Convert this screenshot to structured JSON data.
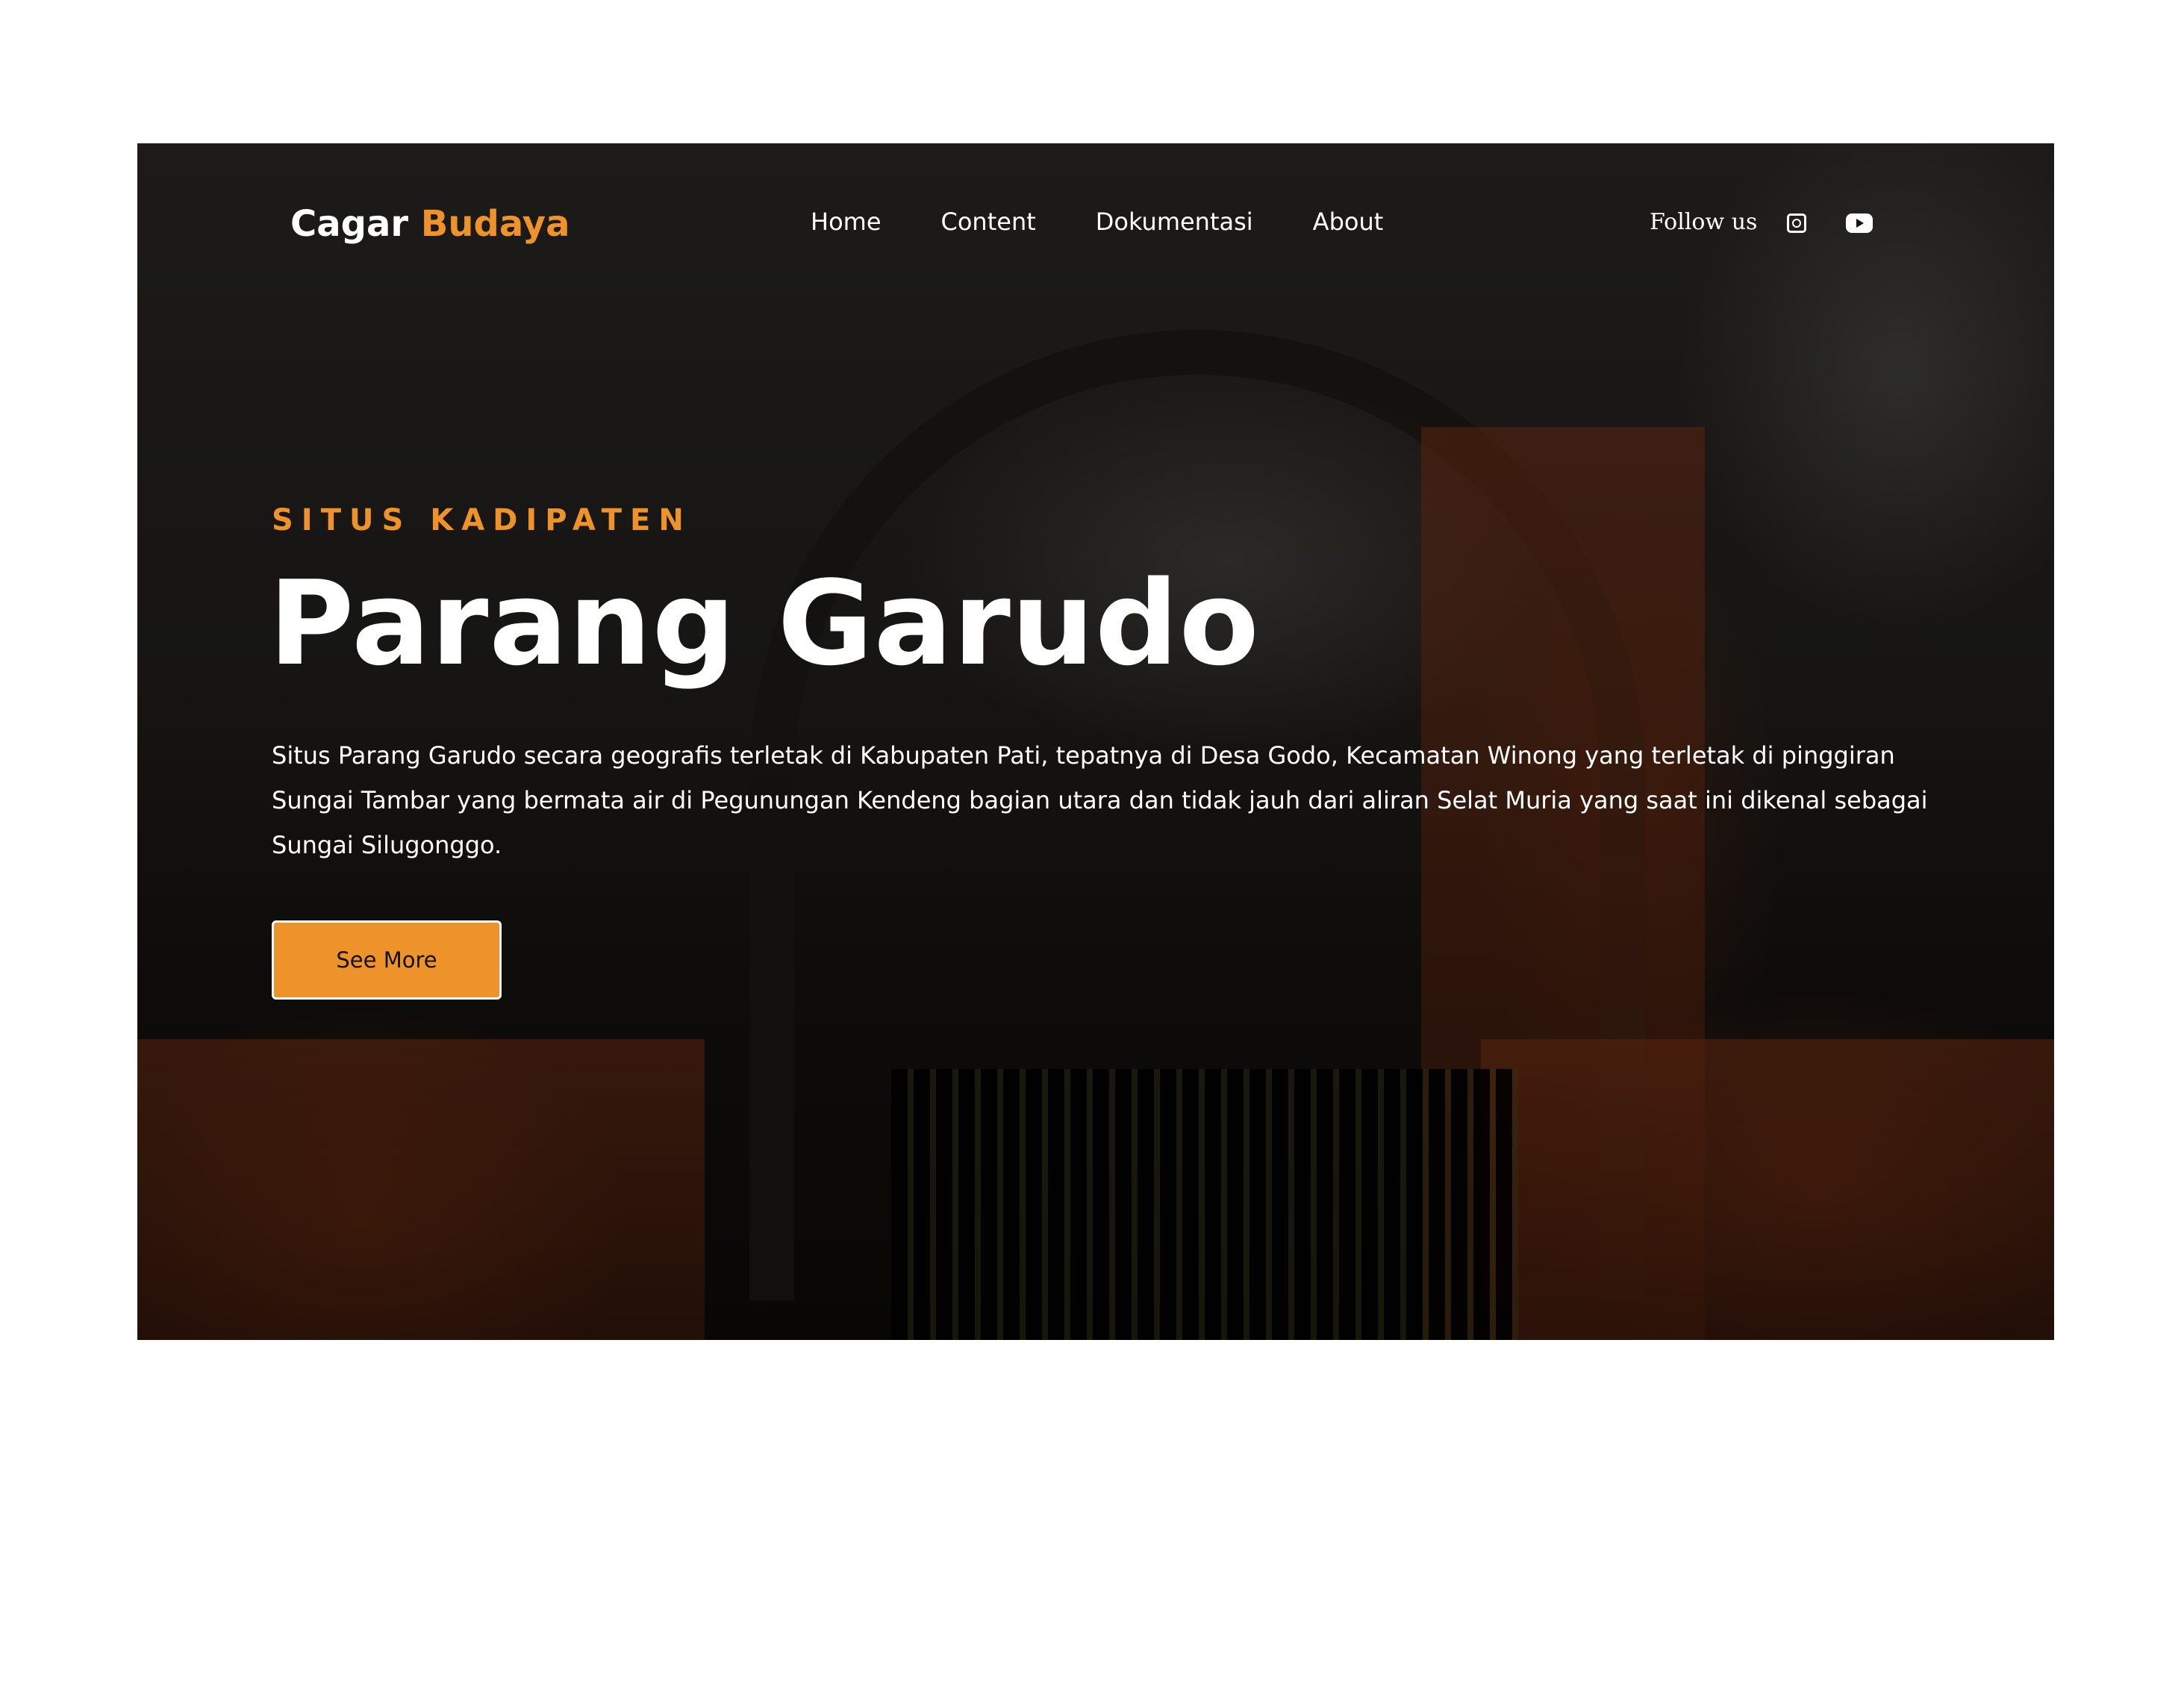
{
  "brand": {
    "name_part1": "Cagar",
    "name_part2": "Budaya"
  },
  "nav": {
    "items": [
      {
        "label": "Home"
      },
      {
        "label": "Content"
      },
      {
        "label": "Dokumentasi"
      },
      {
        "label": "About"
      }
    ]
  },
  "social": {
    "follow_label": "Follow us",
    "icons": [
      "instagram-icon",
      "youtube-icon"
    ]
  },
  "hero": {
    "eyebrow": "SITUS KADIPATEN",
    "title": "Parang Garudo",
    "description": "Situs Parang Garudo secara geografis terletak di Kabupaten Pati, tepatnya di Desa Godo, Kecamatan Winong yang terletak di pinggiran Sungai Tambar yang bermata air di Pegunungan Kendeng bagian utara dan tidak jauh dari aliran Selat Muria yang saat ini dikenal sebagai Sungai Silugonggo.",
    "cta_label": "See More"
  },
  "colors": {
    "accent": "#ee922a",
    "text": "#ffffff",
    "page_background": "#ffffff"
  }
}
